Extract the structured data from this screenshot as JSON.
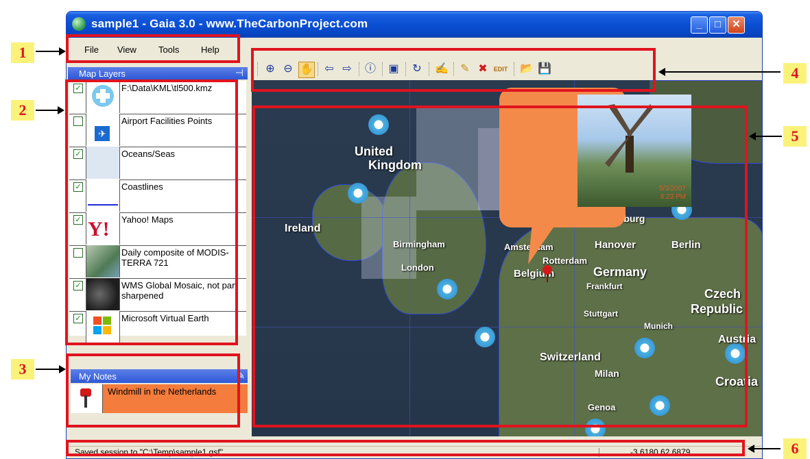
{
  "window": {
    "title": "sample1 - Gaia 3.0 - www.TheCarbonProject.com",
    "controls": {
      "minimize": "_",
      "maximize": "□",
      "close": "✕"
    }
  },
  "menu": {
    "items": [
      "File",
      "View",
      "Tools",
      "Help"
    ]
  },
  "map_layers": {
    "title": "Map Layers",
    "items": [
      {
        "label": "F:\\Data\\KML\\tl500.kmz",
        "checked": true,
        "icon": "kml-cross-icon"
      },
      {
        "label": "Airport Facilities Points",
        "checked": false,
        "icon": "airplane-icon"
      },
      {
        "label": "Oceans/Seas",
        "checked": true,
        "icon": "ocean-swatch-icon"
      },
      {
        "label": "Coastlines",
        "checked": true,
        "icon": "coastline-line-icon"
      },
      {
        "label": "Yahoo! Maps",
        "checked": true,
        "icon": "yahoo-logo-icon"
      },
      {
        "label": "Daily composite of MODIS-TERRA 721",
        "checked": false,
        "icon": "satellite-thumb-icon"
      },
      {
        "label": "WMS Global Mosaic, not pan sharpened",
        "checked": true,
        "icon": "mosaic-thumb-icon"
      },
      {
        "label": "Microsoft Virtual Earth",
        "checked": true,
        "icon": "windows-logo-icon"
      }
    ]
  },
  "notes": {
    "title": "My Notes",
    "items": [
      {
        "label": "Windmill in the Netherlands",
        "icon": "pushpin-icon",
        "highlight": "#f47c3c"
      }
    ]
  },
  "toolbar": {
    "buttons": [
      "zoom-in-icon",
      "zoom-out-icon",
      "pan-hand-icon",
      "back-arrow-icon",
      "forward-arrow-icon",
      "info-icon",
      "full-extent-icon",
      "refresh-icon",
      "add-note-icon",
      "edit-icon",
      "delete-icon",
      "edit-label-icon",
      "open-folder-icon",
      "save-icon"
    ]
  },
  "map": {
    "labels": [
      "United",
      "Kingdom",
      "Ireland",
      "Birmingham",
      "London",
      "Amsterdam",
      "Rotterdam",
      "Belgium",
      "Hamburg",
      "Hanover",
      "Berlin",
      "Germany",
      "Frankfurt",
      "Stuttgart",
      "Munich",
      "Czech",
      "Republic",
      "Austria",
      "Switzerland",
      "Milan",
      "Croatia",
      "Genoa"
    ],
    "photo_timestamp": [
      "5/3/2007",
      "8:23 PM"
    ]
  },
  "status_bar": {
    "message": "Saved session to \"C:\\Temp\\sample1.gsf\"",
    "coordinates": "-3.6180,62.6879"
  },
  "annotations": {
    "numbers": [
      "1",
      "2",
      "3",
      "4",
      "5",
      "6"
    ],
    "box_color": "#e0141e"
  }
}
